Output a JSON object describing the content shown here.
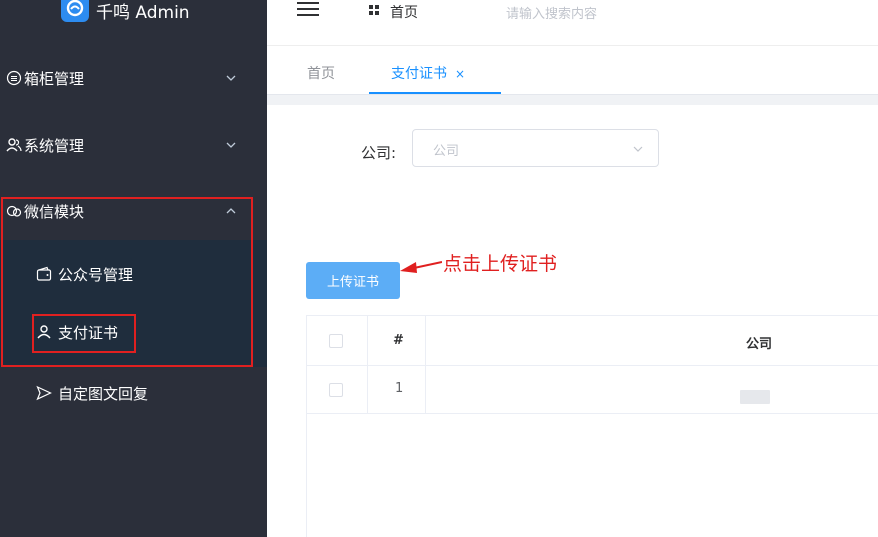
{
  "app": {
    "title": "千鸣 Admin"
  },
  "sidebar": {
    "items": [
      {
        "label": "箱柜管理",
        "icon": "cabinet-icon",
        "expanded": false
      },
      {
        "label": "系统管理",
        "icon": "users-icon",
        "expanded": false
      },
      {
        "label": "微信模块",
        "icon": "wechat-icon",
        "expanded": true,
        "children": [
          {
            "label": "公众号管理",
            "icon": "wallet-icon",
            "active": false
          },
          {
            "label": "支付证书",
            "icon": "user-icon",
            "active": true
          },
          {
            "label": "自定图文回复",
            "icon": "send-icon",
            "active": false
          }
        ]
      }
    ]
  },
  "header": {
    "breadcrumb": "首页",
    "search_placeholder": "请输入搜索内容"
  },
  "tabs": [
    {
      "label": "首页",
      "active": false
    },
    {
      "label": "支付证书",
      "active": true,
      "close": "×"
    }
  ],
  "form": {
    "company_label": "公司:",
    "company_placeholder": "公司"
  },
  "toolbar": {
    "upload_label": "上传证书"
  },
  "annotation": {
    "text": "点击上传证书"
  },
  "table": {
    "columns": [
      "#",
      "公司"
    ],
    "rows": [
      {
        "index": "1"
      }
    ]
  },
  "colors": {
    "sidebar_bg": "#2b2f3a",
    "accent": "#1890ff",
    "annotation": "#e02020",
    "button": "#5cadf6"
  }
}
